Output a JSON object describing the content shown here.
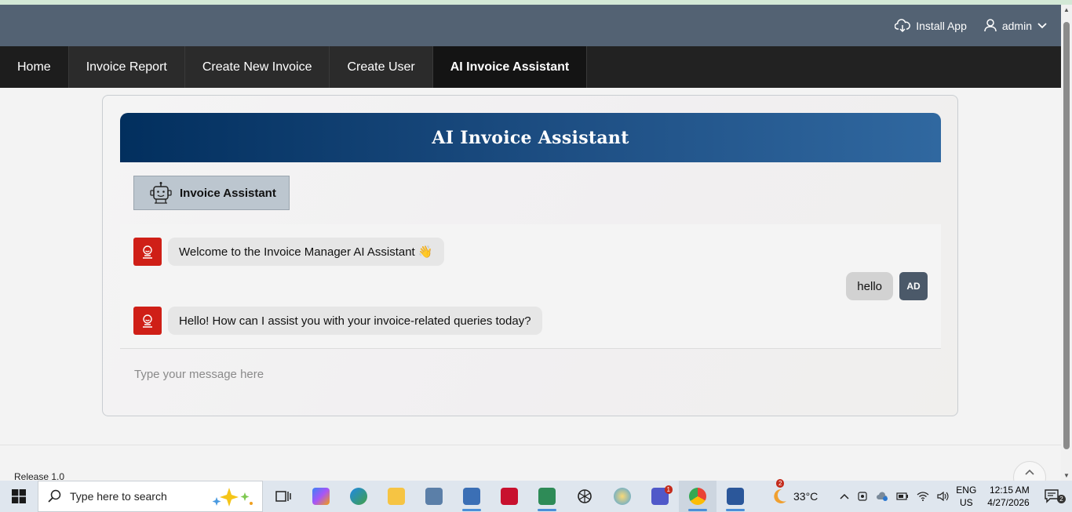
{
  "header": {
    "install_label": "Install App",
    "user_label": "admin"
  },
  "nav": {
    "tabs": [
      {
        "label": "Home"
      },
      {
        "label": "Invoice Report"
      },
      {
        "label": "Create New Invoice"
      },
      {
        "label": "Create User"
      },
      {
        "label": "AI Invoice Assistant"
      }
    ]
  },
  "assistant": {
    "title": "AI Invoice Assistant",
    "button_label": "Invoice Assistant",
    "messages": [
      {
        "role": "bot",
        "text": "Welcome to the Invoice Manager AI Assistant 👋"
      },
      {
        "role": "user",
        "text": "hello",
        "avatar": "AD"
      },
      {
        "role": "bot",
        "text": "Hello! How can I assist you with your invoice-related queries today?"
      }
    ],
    "input_placeholder": "Type your message here"
  },
  "footer": {
    "release": "Release 1.0"
  },
  "taskbar": {
    "search_placeholder": "Type here to search",
    "weather": {
      "temp": "33°C",
      "badge": "2"
    },
    "teams_badge": "1",
    "lang": {
      "line1": "ENG",
      "line2": "US"
    },
    "clock": {
      "time": "12:15 AM",
      "date": "4/27/2026"
    },
    "notifications": "2"
  },
  "colors": {
    "topbar": "#536273",
    "nav": "#222222",
    "banner_start": "#022f5e",
    "banner_end": "#3068a0",
    "bot_avatar": "#cf1f17",
    "user_avatar": "#4b5969"
  }
}
